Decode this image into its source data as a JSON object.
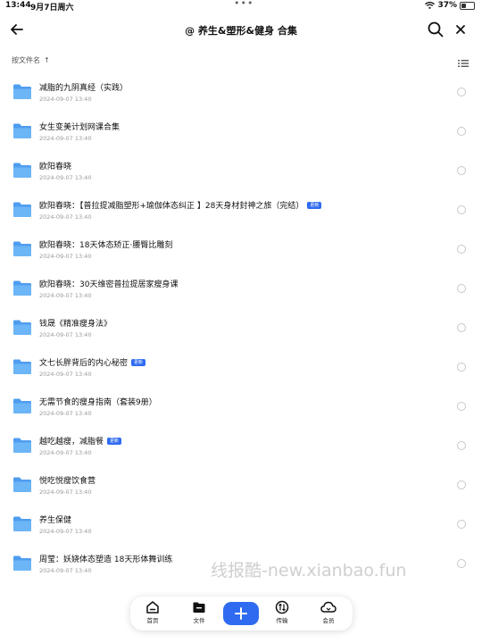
{
  "status_bar": {
    "time": "13:44",
    "date": "9月7日周六",
    "battery": "37%",
    "battery_level": 0.37
  },
  "header": {
    "title": "@ 养生&塑形&健身 合集"
  },
  "sort": {
    "label": "按文件名",
    "arrow": "↑"
  },
  "files": [
    {
      "name": "减脂的九阴真经（实践）",
      "date": "2024-09-07 13:40",
      "badge": ""
    },
    {
      "name": "女生变美计划网课合集",
      "date": "2024-09-07 13:40",
      "badge": ""
    },
    {
      "name": "欧阳春晓",
      "date": "2024-09-07 13:40",
      "badge": ""
    },
    {
      "name": "欧阳春晓：【普拉提减脂塑形+瑜伽体态纠正 】28天身材封神之旅（完结）",
      "date": "2024-09-07 13:40",
      "badge": "更新"
    },
    {
      "name": "欧阳春晓：18天体态矫正·腰臀比雕刻",
      "date": "2024-09-07 13:40",
      "badge": ""
    },
    {
      "name": "欧阳春晓：30天维密普拉提居家瘦身课",
      "date": "2024-09-07 13:40",
      "badge": ""
    },
    {
      "name": "钱晟《精准瘦身法》",
      "date": "2024-09-07 13:40",
      "badge": ""
    },
    {
      "name": "文七长胖背后的内心秘密",
      "date": "2024-09-07 13:40",
      "badge": "更新"
    },
    {
      "name": "无需节食的瘦身指南（套装9册）",
      "date": "2024-09-07 13:40",
      "badge": ""
    },
    {
      "name": "越吃越瘦，减脂餐",
      "date": "2024-09-07 13:40",
      "badge": "更新"
    },
    {
      "name": "悦吃悦瘦饮食营",
      "date": "2024-09-07 13:40",
      "badge": ""
    },
    {
      "name": "养生保健",
      "date": "2024-09-07 13:40",
      "badge": ""
    },
    {
      "name": "周莹：妖娆体态塑造 18天形体舞训练",
      "date": "2024-09-07 13:40",
      "badge": ""
    }
  ],
  "watermark": "线报酷-new.xianbao.fun",
  "tabs": {
    "home": "首页",
    "files": "文件",
    "transfer": "传输",
    "member": "会员"
  },
  "icons": {
    "back": "arrow-left-icon",
    "search": "search-icon",
    "close": "close-icon",
    "list_mode": "list-icon",
    "folder": "folder-icon",
    "plus": "plus-icon"
  },
  "colors": {
    "accent": "#2f6bf0",
    "folder": "#5aa8f2"
  }
}
